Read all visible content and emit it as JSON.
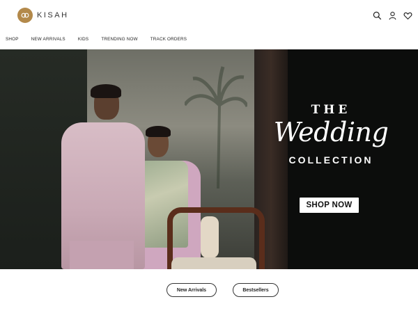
{
  "brand": {
    "name": "KISAH",
    "icon": "kisah-logo-icon",
    "accent": "#b3894a"
  },
  "header": {
    "icons": [
      {
        "name": "search-icon",
        "label": "Search"
      },
      {
        "name": "account-icon",
        "label": "Account"
      },
      {
        "name": "wishlist-icon",
        "label": "Wishlist"
      }
    ]
  },
  "nav": {
    "items": [
      {
        "label": "SHOP"
      },
      {
        "label": "NEW ARRIVALS"
      },
      {
        "label": "KIDS"
      },
      {
        "label": "TRENDING NOW"
      },
      {
        "label": "TRACK ORDERS"
      }
    ]
  },
  "hero": {
    "line1": "THE",
    "line2": "Wedding",
    "line3": "COLLECTION",
    "cta": "SHOP NOW"
  },
  "tabs": [
    {
      "label": "New Arrivals"
    },
    {
      "label": "Bestsellers"
    }
  ]
}
